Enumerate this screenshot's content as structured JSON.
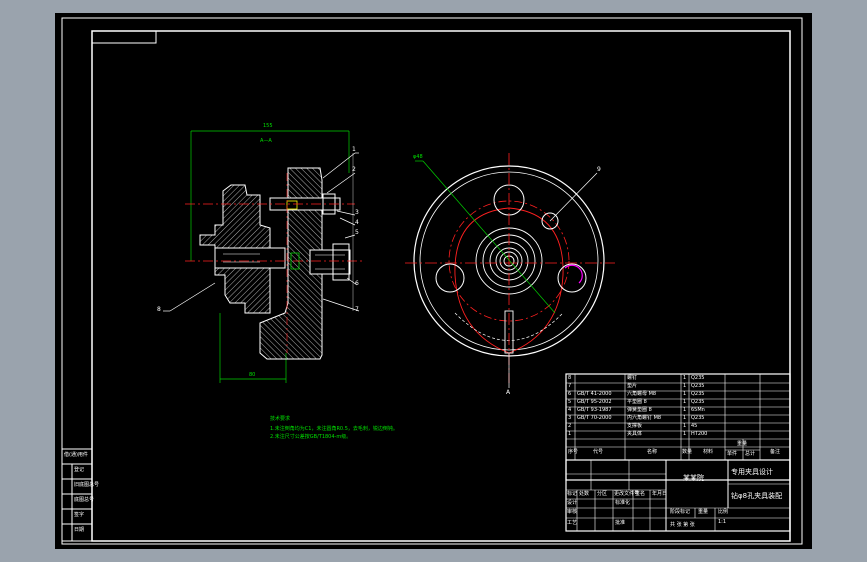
{
  "colors": {
    "background": "#9aa3ad",
    "canvas": "#000000",
    "lines": "#ffffff",
    "centerlines": "#ff2020",
    "dimension": "#00d000",
    "hatch": "#ffffff",
    "highlight": "#ff00ff"
  },
  "section_view": {
    "dim_top": "155",
    "section_label": "A—A",
    "dim_bottom": "80",
    "callouts": [
      "1",
      "2",
      "3",
      "4",
      "5",
      "6",
      "7",
      "8"
    ]
  },
  "front_view": {
    "dim_label": "φ48",
    "callout_top": "9",
    "callout_bottom": "A"
  },
  "notes": {
    "heading": "技术要求",
    "lines": [
      "1.未注倒角均为C1，未注圆角R0.5，去毛刺，锐边倒钝。",
      "2.未注尺寸公差按GB/T1804-m级。"
    ]
  },
  "parts_list": {
    "rows": [
      {
        "no": "8",
        "code": "",
        "name": "螺钉",
        "qty": "1",
        "mat": "Q235"
      },
      {
        "no": "7",
        "code": "",
        "name": "垫片",
        "qty": "1",
        "mat": "Q235"
      },
      {
        "no": "6",
        "code": "GB/T 41-2000",
        "name": "六角螺母 M8",
        "qty": "1",
        "mat": "Q235"
      },
      {
        "no": "5",
        "code": "GB/T 95-2002",
        "name": "平垫圈 8",
        "qty": "1",
        "mat": "Q235"
      },
      {
        "no": "4",
        "code": "GB/T 93-1987",
        "name": "弹簧垫圈 8",
        "qty": "1",
        "mat": "65Mn"
      },
      {
        "no": "3",
        "code": "GB/T 70-2000",
        "name": "内六角螺钉 M8",
        "qty": "1",
        "mat": "Q235"
      },
      {
        "no": "2",
        "code": "",
        "name": "支撑板",
        "qty": "1",
        "mat": "45"
      },
      {
        "no": "1",
        "code": "",
        "name": "夹具体",
        "qty": "1",
        "mat": "HT200"
      }
    ],
    "header": [
      "序号",
      "代号",
      "名称",
      "数量",
      "材料",
      "单件",
      "总计",
      "备注"
    ],
    "weight_header": "重量"
  },
  "title_block": {
    "drawing_title": "专用夹具设计",
    "school": "某某院",
    "part_name": "钻φ8孔夹具装配",
    "mark_labels": [
      "标记",
      "处数",
      "分区",
      "更改文件号",
      "签名",
      "年月日"
    ],
    "design_labels": [
      "设计",
      "审核",
      "工艺",
      "标准化",
      "批准"
    ],
    "stage_labels": [
      "阶段标记",
      "重量",
      "比例"
    ],
    "scale": "1:1",
    "sheet_info": "共 张 第 张"
  },
  "side_table": {
    "rows": [
      "借(通)用件",
      "登记",
      "旧底图总号",
      "底图总号",
      "签字",
      "日期"
    ]
  }
}
